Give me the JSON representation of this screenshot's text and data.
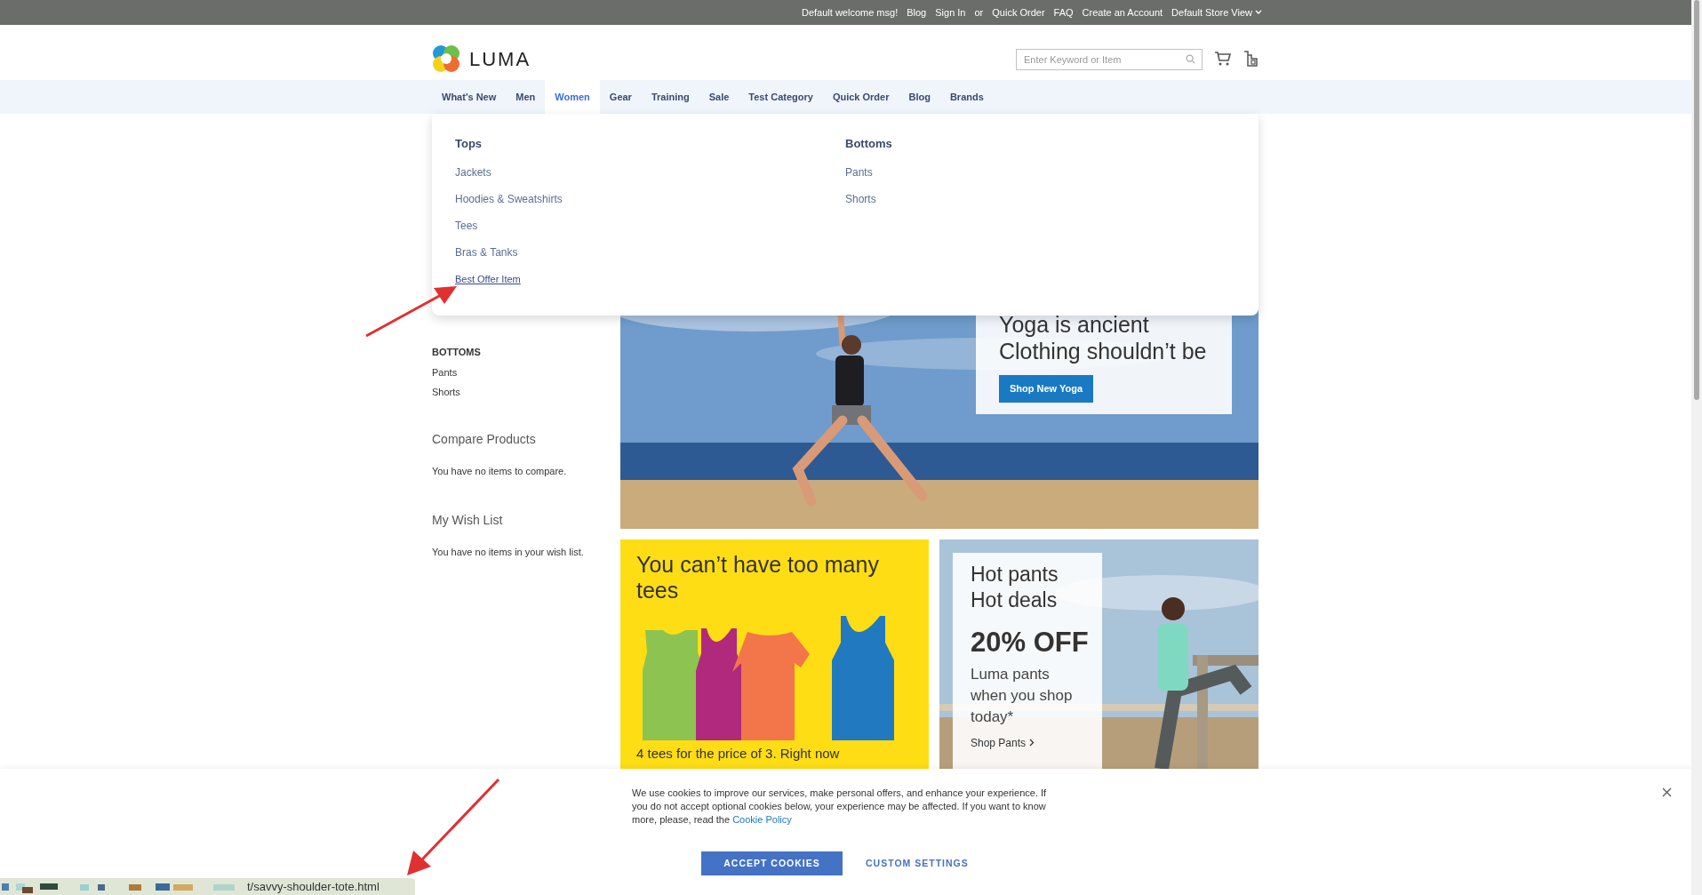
{
  "top_bar": [
    {
      "text": "Default welcome msg!",
      "kind": "text"
    },
    {
      "text": "Blog",
      "kind": "link"
    },
    {
      "text": "Sign In",
      "kind": "link"
    },
    {
      "text": "or",
      "kind": "text"
    },
    {
      "text": "Quick Order",
      "kind": "link"
    },
    {
      "text": "FAQ",
      "kind": "link"
    },
    {
      "text": "Create an Account",
      "kind": "link"
    },
    {
      "text": "Default Store View",
      "kind": "dropdown"
    }
  ],
  "logo": {
    "text": "LUMA"
  },
  "search": {
    "placeholder": "Enter Keyword or Item"
  },
  "nav": [
    {
      "label": "What's New",
      "selected": false
    },
    {
      "label": "Men",
      "selected": false
    },
    {
      "label": "Women",
      "selected": true
    },
    {
      "label": "Gear",
      "selected": false
    },
    {
      "label": "Training",
      "selected": false
    },
    {
      "label": "Sale",
      "selected": false
    },
    {
      "label": "Test Category",
      "selected": false
    },
    {
      "label": "Quick Order",
      "selected": false
    },
    {
      "label": "Blog",
      "selected": false
    },
    {
      "label": "Brands",
      "selected": false
    }
  ],
  "mega_menu": [
    {
      "heading": "Tops",
      "items": [
        {
          "label": "Jackets",
          "hovered": false
        },
        {
          "label": "Hoodies & Sweatshirts",
          "hovered": false
        },
        {
          "label": "Tees",
          "hovered": false
        },
        {
          "label": "Bras & Tanks",
          "hovered": false
        },
        {
          "label": "Best Offer Item",
          "hovered": true
        }
      ]
    },
    {
      "heading": "Bottoms",
      "items": [
        {
          "label": "Pants",
          "hovered": false
        },
        {
          "label": "Shorts",
          "hovered": false
        }
      ]
    }
  ],
  "sidebar": {
    "group_heading": "BOTTOMS",
    "items": [
      "Pants",
      "Shorts"
    ],
    "compare": {
      "title": "Compare Products",
      "text": "You have no items to compare."
    },
    "wishlist": {
      "title": "My Wish List",
      "text": "You have no items in your wish list."
    }
  },
  "hero": {
    "headline_lines": [
      "Yoga is ancient",
      "Clothing shouldn’t be"
    ],
    "button": "Shop New Yoga"
  },
  "tees_banner": {
    "title": "You can’t have too many tees",
    "text": "4 tees for the price of 3. Right now"
  },
  "pants_banner": {
    "lines": [
      "Hot pants",
      "Hot deals"
    ],
    "offer": "20% OFF",
    "text": "Luma pants when you shop today*",
    "link": "Shop Pants"
  },
  "cookie_notice": {
    "text": "We use cookies to improve our services, make personal offers, and enhance your experience. If you do not accept optional cookies below, your experience may be affected. If you want to know more, please, read the ",
    "link": "Cookie Policy",
    "accept": "ACCEPT COOKIES",
    "custom": "CUSTOM SETTINGS"
  },
  "status_bar": {
    "url": "t/savvy-shoulder-tote.html"
  }
}
